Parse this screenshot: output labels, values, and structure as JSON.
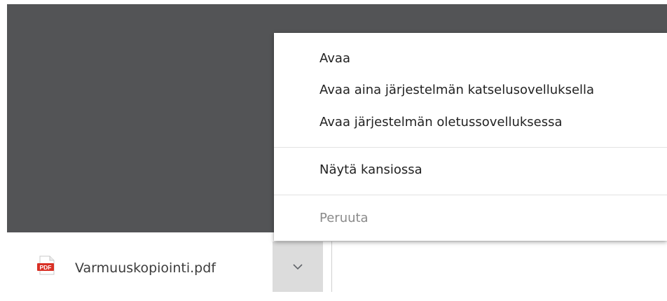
{
  "context_menu": {
    "items": [
      {
        "label": "Avaa"
      },
      {
        "label": "Avaa aina järjestelmän katselusovelluksella"
      },
      {
        "label": "Avaa järjestelmän oletussovelluksessa"
      },
      {
        "label": "Näytä kansiossa"
      },
      {
        "label": "Peruuta",
        "disabled": true
      }
    ]
  },
  "download_bar": {
    "file_name": "Varmuuskopiointi.pdf",
    "file_icon": "pdf-file-icon",
    "file_icon_text": "PDF",
    "menu_button_icon": "chevron-down-icon"
  },
  "colors": {
    "backdrop": "#535456",
    "pdf_red": "#d93025"
  }
}
